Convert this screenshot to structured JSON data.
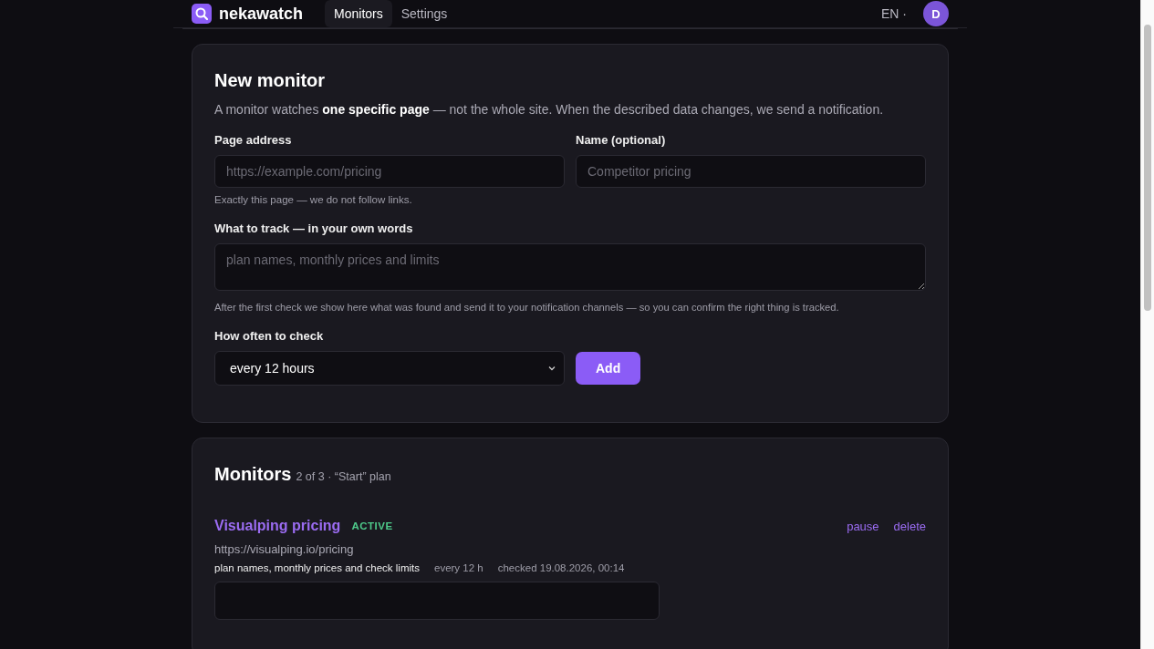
{
  "header": {
    "logo": "nekawatch",
    "nav": [
      {
        "label": "Monitors",
        "selected": true
      },
      {
        "label": "Settings",
        "selected": false
      }
    ],
    "language": "EN ·",
    "avatar": "D"
  },
  "new_monitor": {
    "title": "New monitor",
    "intro": "A monitor watches **one specific page** — not the whole site. When the described data changes, we send a notification.",
    "address": {
      "label": "Page address",
      "placeholder": "https://example.com/pricing",
      "hint": "Exactly this page — we do not follow links."
    },
    "name": {
      "label": "Name (optional)",
      "placeholder": "Competitor pricing"
    },
    "track": {
      "label": "What to track — in your own words",
      "placeholder": "plan names, monthly prices and limits",
      "hint": "After the first check we show here what was found and send it to your notification channels — so you can confirm the right thing is tracked."
    },
    "frequency": {
      "label": "How often to check",
      "value": "every 12 hours"
    },
    "add_button": "Add"
  },
  "monitors": {
    "title": "Monitors",
    "subtitle": "2 of 3 · “Start” plan",
    "items": [
      {
        "name": "Visualping pricing",
        "status": "ACTIVE",
        "url": "https://visualping.io/pricing",
        "tracks": "plan names, monthly prices and check limits",
        "interval": "every 12 h",
        "checked": "checked 19.08.2026, 00:14",
        "actions": [
          "pause",
          "delete"
        ]
      }
    ]
  }
}
